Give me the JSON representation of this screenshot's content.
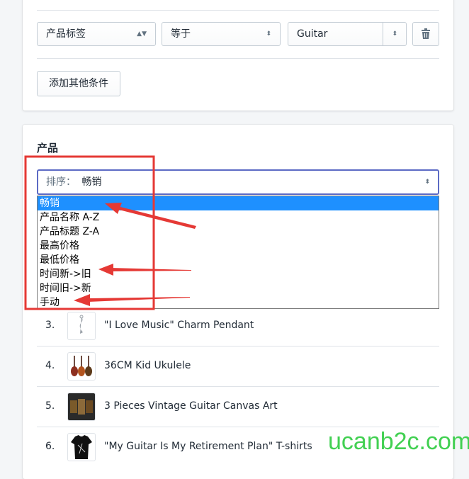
{
  "conditions": {
    "field": "产品标签",
    "operator": "等于",
    "value": "Guitar",
    "add_condition_label": "添加其他条件"
  },
  "products": {
    "title": "产品",
    "sort_prefix": "排序：",
    "sort_value": "畅销",
    "sort_options": [
      "畅销",
      "产品名称 A-Z",
      "产品标题 Z-A",
      "最高价格",
      "最低价格",
      "时间新->旧",
      "时间旧->新",
      "手动"
    ],
    "items": [
      {
        "num": "3.",
        "name": "\"I Love Music\" Charm Pendant",
        "thumb": "pendant"
      },
      {
        "num": "4.",
        "name": "36CM Kid Ukulele",
        "thumb": "ukulele"
      },
      {
        "num": "5.",
        "name": "3 Pieces Vintage Guitar Canvas Art",
        "thumb": "canvas"
      },
      {
        "num": "6.",
        "name": "\"My Guitar Is My Retirement Plan\" T-shirts",
        "thumb": "tshirt"
      }
    ]
  },
  "watermark": "ucanb2c.com",
  "colors": {
    "highlight": "#1e90ff",
    "annotation": "#e53935",
    "watermark": "#2ecc40",
    "focus_border": "#5c6ac4"
  }
}
